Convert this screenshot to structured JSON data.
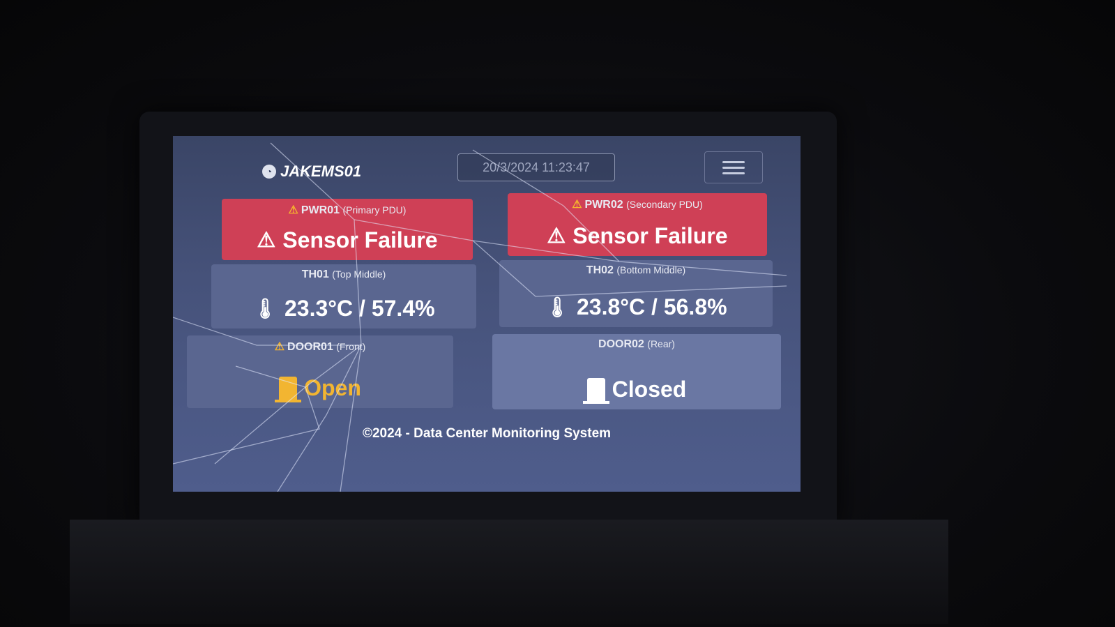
{
  "header": {
    "brand": "JAKEMS01",
    "datetime": "20/3/2024 11:23:47"
  },
  "cards": {
    "pwr01": {
      "name": "PWR01",
      "desc": "(Primary PDU)",
      "value": "Sensor Failure",
      "status_color": "#cf4056"
    },
    "pwr02": {
      "name": "PWR02",
      "desc": "(Secondary PDU)",
      "value": "Sensor Failure",
      "status_color": "#cf4056"
    },
    "th01": {
      "name": "TH01",
      "desc": "(Top Middle)",
      "value": "23.3°C / 57.4%"
    },
    "th02": {
      "name": "TH02",
      "desc": "(Bottom Middle)",
      "value": "23.8°C / 56.8%"
    },
    "door01": {
      "name": "DOOR01",
      "desc": "(Front)",
      "value": "Open",
      "status_color": "#f2b531"
    },
    "door02": {
      "name": "DOOR02",
      "desc": "(Rear)",
      "value": "Closed"
    }
  },
  "footer": {
    "text": "©2024 - Data Center Monitoring System"
  },
  "icons": {
    "brand": "dashboard-icon",
    "warning": "warning-triangle-icon",
    "thermometer": "thermometer-icon",
    "door": "door-icon",
    "menu": "hamburger-menu-icon"
  }
}
